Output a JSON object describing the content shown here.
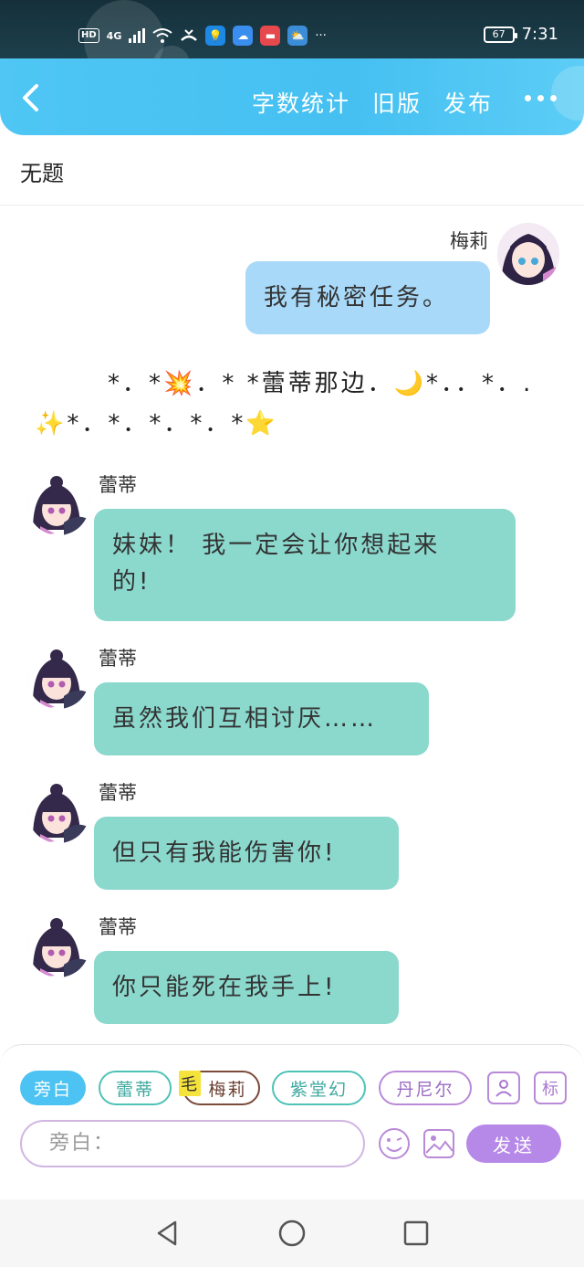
{
  "status_bar": {
    "hd": "HD",
    "signal": "4G",
    "more": "···",
    "battery": "67",
    "time": "7:31"
  },
  "header": {
    "actions": [
      "字数统计",
      "旧版",
      "发布"
    ],
    "more_icon": "more-dots-icon",
    "back_icon": "chevron-left-icon",
    "color": "#4fc6f4"
  },
  "document": {
    "title": "无题"
  },
  "chat": {
    "messages": [
      {
        "speaker": "梅莉",
        "side": "right",
        "text": "我有秘密任务。"
      },
      {
        "speaker": "蕾蒂",
        "side": "left",
        "text_lines": [
          "妹妹！ 我一定会让你想起来",
          "的!"
        ]
      },
      {
        "speaker": "蕾蒂",
        "side": "left",
        "text": "虽然我们互相讨厌……"
      },
      {
        "speaker": "蕾蒂",
        "side": "left",
        "text": "但只有我能伤害你!"
      },
      {
        "speaker": "蕾蒂",
        "side": "left",
        "text": "你只能死在我手上!"
      }
    ],
    "narration": {
      "line1": "*．*💥．*  *蕾蒂那边．🌙*．．*．.",
      "line2": "✨*．*．*．*．*⭐"
    },
    "bubble_colors": {
      "me": "#a8d9f8",
      "them": "#8bd8cd"
    }
  },
  "composer": {
    "roles": [
      {
        "label": "旁白",
        "selected": true
      },
      {
        "label": "蕾蒂"
      },
      {
        "label": "梅莉",
        "prefix": "毛"
      },
      {
        "label": "紫堂幻"
      },
      {
        "label": "丹尼尔"
      }
    ],
    "role_icon": "user-card-icon",
    "tag_label": "标",
    "input_placeholder": "旁白：",
    "emoji_icon": "emoji-icon",
    "image_icon": "image-icon",
    "send_label": "发送",
    "accent": "#b689e8"
  },
  "navbar": {
    "back_icon": "triangle-back-icon",
    "home_icon": "circle-home-icon",
    "recent_icon": "square-recent-icon"
  }
}
